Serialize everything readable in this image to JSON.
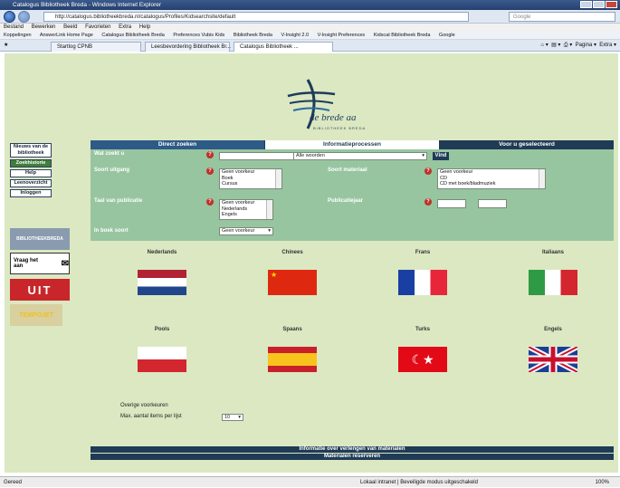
{
  "window": {
    "title": "Catalogus Bibliotheek Breda - Windows Internet Explorer"
  },
  "browser": {
    "address": "http://catalogus.bibliotheekbreda.nl/catalogus/Profiles/Kidsearchsite/default",
    "search_placeholder": "Google",
    "menu": [
      "Bestand",
      "Bewerken",
      "Beeld",
      "Favorieten",
      "Extra",
      "Help"
    ],
    "favorites": [
      "Koppelingen",
      "AnswerLink Home Page",
      "Catalogus Bibliotheek Breda",
      "Preferences Vubis Kids",
      "Bibliotheek Breda",
      "V-Insight 2.0",
      "V-Insight Preferences",
      "Kidscat Bibliotheek Breda",
      "Google"
    ],
    "tabs": [
      "Startlog CPNB",
      "Leesbevordering Bibliotheek Br...",
      "Catalogus Bibliotheek ..."
    ],
    "tools": [
      "Pagina",
      "Extra"
    ]
  },
  "logo": {
    "brand": "de brede aa",
    "sub": "BIBLIOTHEEK BREDA"
  },
  "sidenav": [
    "Nieuws van de bibliotheek",
    "Zoekhistorie",
    "Help",
    "Leenoverzicht",
    "Inloggen"
  ],
  "promos": [
    "BIBLIOTHEEKBREDA",
    "Vraag het aan",
    "UIT",
    "TEMPOJET"
  ],
  "form": {
    "tabs": [
      "Direct zoeken",
      "Informatieprocessen",
      "Voor u geselecteerd"
    ],
    "wat_label": "Wat zoekt u",
    "wat_value": "",
    "scope_value": "Alle woorden",
    "go_label": "Vind",
    "soort_label": "Soort uitgang",
    "soort_options": [
      "Geen voorkeur",
      "Boek",
      "Cursus"
    ],
    "media_label": "Soort materiaal",
    "media_options": [
      "Geen voorkeur",
      "CD",
      "CD met boek/bladmuziek"
    ],
    "taal_label": "Taal van publicatie",
    "taal_options": [
      "Geen voorkeur",
      "Nederlands",
      "Engels"
    ],
    "jaar_label": "Publicatiejaar",
    "jaar_from": "",
    "jaar_to": "",
    "boek_label": "In boek soort",
    "boek_value": "Geen voorkeur"
  },
  "languages": [
    "Nederlands",
    "Chinees",
    "Frans",
    "Italiaans",
    "Pools",
    "Spaans",
    "Turks",
    "Engels"
  ],
  "extra": {
    "link": "Overige voorkeuren",
    "perpage_label": "Max. aantal items per lijst",
    "perpage_value": "10"
  },
  "info_bars": [
    "Informatie over verlengen van materialen",
    "Materialen reserveren"
  ],
  "statusbar": {
    "left": "Gereed",
    "zone": "Lokaal intranet | Beveiligde modus uitgeschakeld",
    "zoom": "100%"
  },
  "colors": {
    "page_bg": "#dbe8c2",
    "form_bg": "#97c59f",
    "nav_blue": "#1f3b56"
  }
}
